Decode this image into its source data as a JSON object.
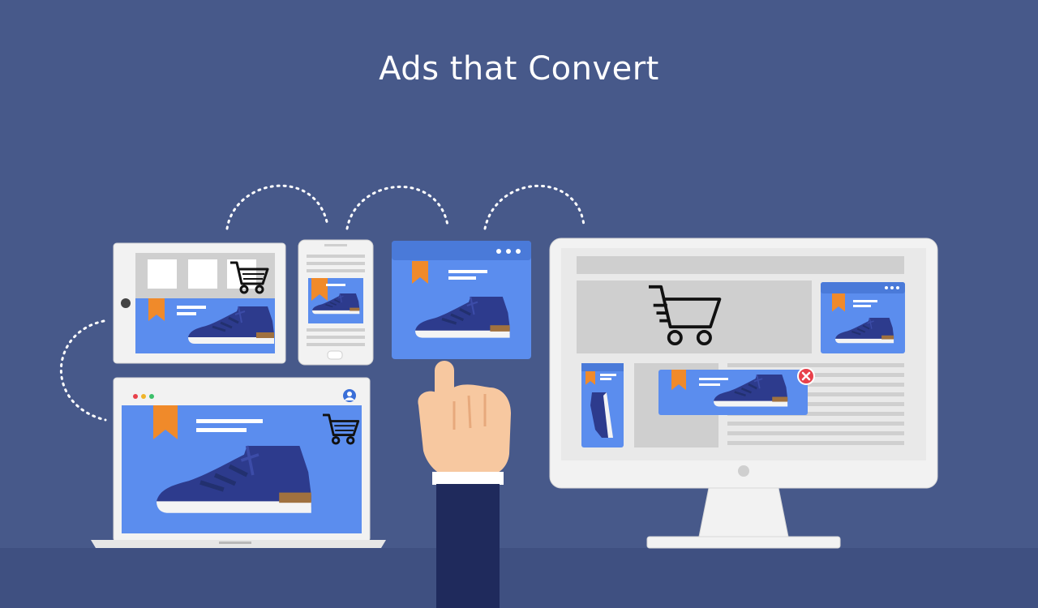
{
  "title": "Ads that Convert",
  "colors": {
    "background": "#47598a",
    "floor": "#3f5081",
    "device_frame": "#f2f2f2",
    "ad_blue": "#5b8dee",
    "shoe_navy": "#2d3b8d",
    "ribbon_orange": "#f08a2a",
    "close_red": "#e8404a",
    "skin": "#f7c8a0",
    "sleeve": "#1f2a5c"
  },
  "icons": [
    "shopping-cart-icon",
    "bookmark-ribbon-icon",
    "close-icon",
    "user-avatar-icon",
    "sneaker-icon",
    "pointing-hand-icon"
  ]
}
